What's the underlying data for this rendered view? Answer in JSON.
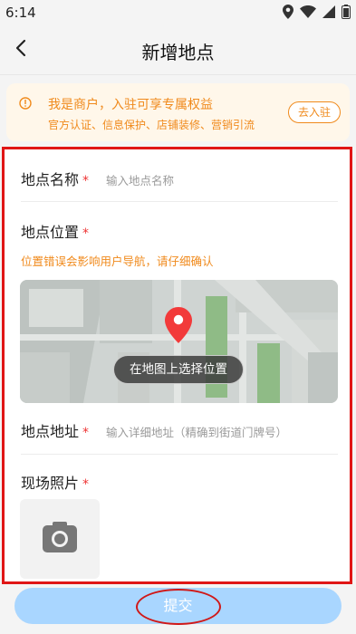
{
  "status_bar": {
    "time": "6:14"
  },
  "nav": {
    "title": "新增地点"
  },
  "banner": {
    "title": "我是商户，入驻可享专属权益",
    "subtitle": "官方认证、信息保护、店铺装修、营销引流",
    "button_label": "去入驻",
    "accent_color": "#f08a1c"
  },
  "form": {
    "name_label": "地点名称",
    "name_required": "*",
    "name_placeholder": "输入地点名称",
    "location_label": "地点位置",
    "location_required": "*",
    "location_warning": "位置错误会影响用户导航，请仔细确认",
    "map_button_label": "在地图上选择位置",
    "address_label": "地点地址",
    "address_required": "*",
    "address_placeholder": "输入详细地址（精确到街道门牌号）",
    "photo_label": "现场照片",
    "photo_required": "*"
  },
  "submit": {
    "label": "提交",
    "color": "#a9d6ff"
  }
}
